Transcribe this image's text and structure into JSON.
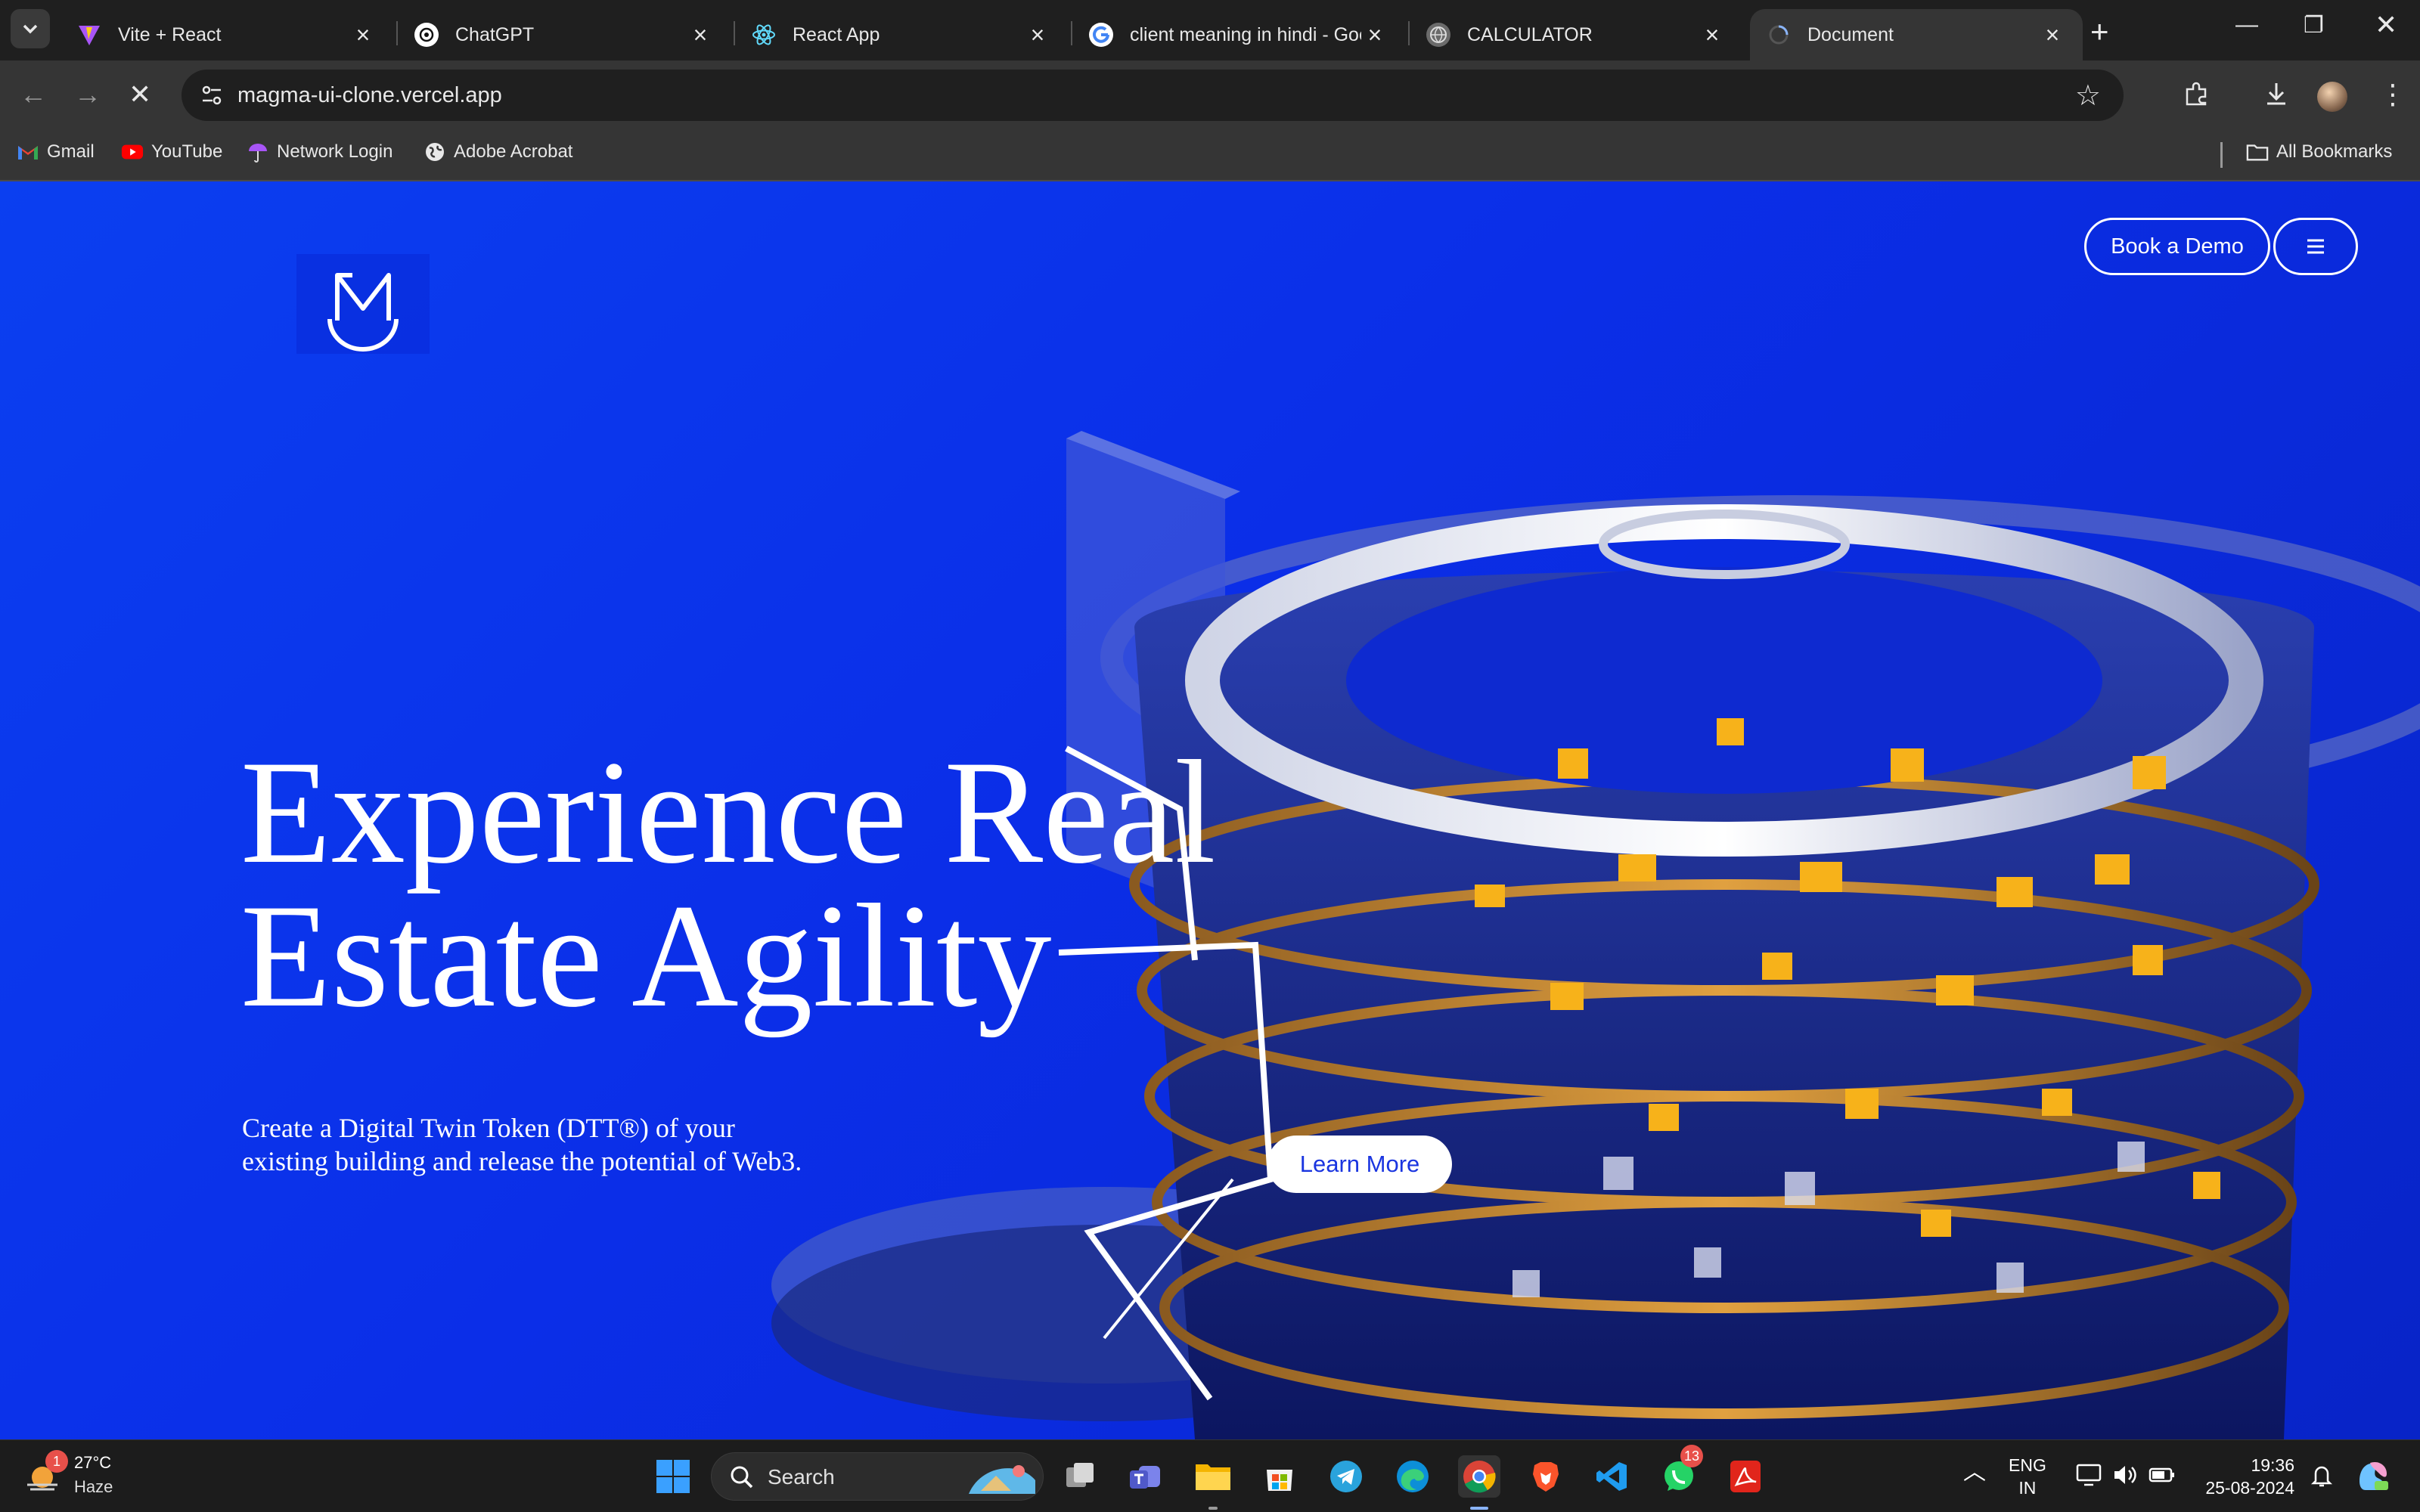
{
  "browser": {
    "tabs": [
      {
        "title": "Vite + React",
        "active": false
      },
      {
        "title": "ChatGPT",
        "active": false
      },
      {
        "title": "React App",
        "active": false
      },
      {
        "title": "client meaning in hindi - Goo",
        "active": false
      },
      {
        "title": "CALCULATOR",
        "active": false
      },
      {
        "title": "Document",
        "active": true
      }
    ],
    "url": "magma-ui-clone.vercel.app",
    "bookmarks": [
      {
        "label": "Gmail"
      },
      {
        "label": "YouTube"
      },
      {
        "label": "Network Login"
      },
      {
        "label": "Adobe Acrobat"
      }
    ],
    "all_bookmarks_label": "All Bookmarks"
  },
  "page": {
    "book_demo_label": "Book a Demo",
    "headline_line1": "Experience Real",
    "headline_line2": "Estate Agility",
    "subtext": "Create a Digital Twin Token (DTT®) of your existing building and release the potential of Web3.",
    "learn_more_label": "Learn More",
    "colors": {
      "background": "#0b2ee8",
      "accent": "#ffffff",
      "button_text": "#1a35e0"
    }
  },
  "taskbar": {
    "weather_temp": "27°C",
    "weather_condition": "Haze",
    "weather_badge": "1",
    "search_label": "Search",
    "whatsapp_badge": "13",
    "language_line1": "ENG",
    "language_line2": "IN",
    "time": "19:36",
    "date": "25-08-2024"
  }
}
